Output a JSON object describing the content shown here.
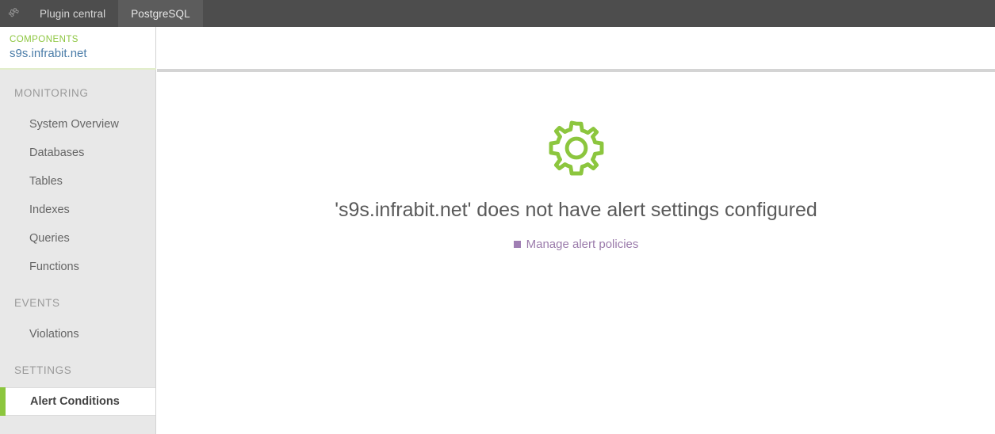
{
  "topbar": {
    "plugin_icon": "puzzle-plugin-icon",
    "tabs": [
      {
        "label": "Plugin central",
        "active": false
      },
      {
        "label": "PostgreSQL",
        "active": true
      }
    ]
  },
  "components_header": {
    "label": "COMPONENTS",
    "value": "s9s.infrabit.net"
  },
  "sidebar": {
    "sections": [
      {
        "title": "MONITORING",
        "items": [
          {
            "label": "System Overview",
            "active": false
          },
          {
            "label": "Databases",
            "active": false
          },
          {
            "label": "Tables",
            "active": false
          },
          {
            "label": "Indexes",
            "active": false
          },
          {
            "label": "Queries",
            "active": false
          },
          {
            "label": "Functions",
            "active": false
          }
        ]
      },
      {
        "title": "EVENTS",
        "items": [
          {
            "label": "Violations",
            "active": false
          }
        ]
      },
      {
        "title": "SETTINGS",
        "items": [
          {
            "label": "Alert Conditions",
            "active": true
          }
        ]
      }
    ]
  },
  "main": {
    "empty_state": {
      "icon": "gear-icon",
      "title": "'s9s.infrabit.net' does not have alert settings configured",
      "link_label": "Manage alert policies",
      "link_bullet": "square-bullet-icon"
    }
  },
  "colors": {
    "accent_green": "#8cc63e",
    "link_purple": "#9b7bab",
    "component_blue": "#4a7ca8",
    "topbar_dark": "#4d4d4d",
    "topbar_tab_active": "#5c5c5c",
    "sidebar_bg": "#e8e8e8"
  }
}
